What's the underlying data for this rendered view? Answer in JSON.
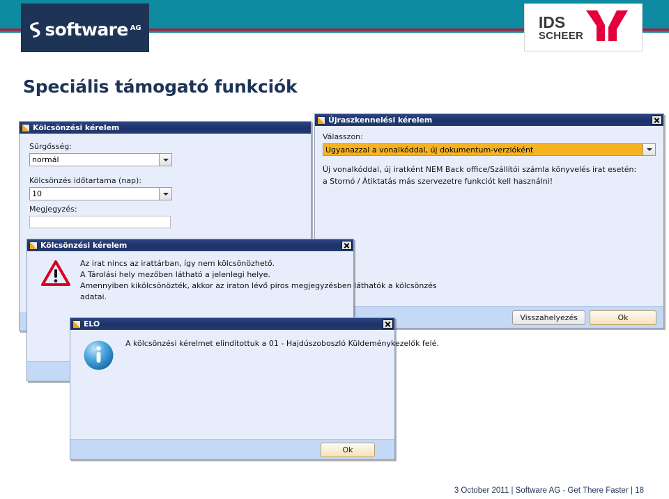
{
  "header": {
    "brand_name": "software",
    "brand_suffix": "AG",
    "partner_line1": "IDS",
    "partner_line2": "SCHEER",
    "teal": "#0e8ba0",
    "red": "#c8102e",
    "navy": "#1e3456"
  },
  "slide": {
    "title": "Speciális támogató funkciók"
  },
  "dialogs": {
    "loan_request_form": {
      "title": "Kölcsönzési kérelem",
      "fields": {
        "urgency_label": "Sűrgősség:",
        "urgency_value": "normál",
        "duration_label": "Kölcsönzés időtartama (nap):",
        "duration_value": "10",
        "note_label": "Megjegyzés:",
        "note_value": ""
      }
    },
    "rescan_request": {
      "title": "Újraszkennelési kérelem",
      "choose_label": "Válasszon:",
      "choice_value": "Ugyanazzal a vonalkóddal, új dokumentum-verzióként",
      "choice_highlight_color": "#f5b324",
      "hint_line1": "Új vonalkóddal, új iratként NEM Back office/Szállítói számla könyvelés irat esetén:",
      "hint_line2": "a Stornó / Átiktatás más szervezetre funkciót kell használni!",
      "buttons": {
        "secondary": "Visszahelyezés",
        "primary": "Ok"
      }
    },
    "loan_request_warning": {
      "title": "Kölcsönzési kérelem",
      "icon": "warning-triangle-icon",
      "line1": "Az irat nincs az irattárban, így nem kölcsönözhető.",
      "line2": "A Tárolási hely mezőben látható a jelenlegi helye.",
      "line3": "Amennyiben kikölcsönözték, akkor az iraton lévő piros megjegyzésben láthatók a kölcsönzés",
      "line4": "adatai."
    },
    "elo_info": {
      "title": "ELO",
      "icon": "info-circle-icon",
      "message": "A kölcsönzési kérelmet elindítottuk a 01 - Hajdúszoboszló Küldeménykezelők felé.",
      "buttons": {
        "primary": "Ok"
      }
    }
  },
  "footer": {
    "date": "3 October 2011",
    "sep1": "|",
    "tagline": "Software AG - Get There Faster",
    "sep2": "|",
    "page": "18"
  }
}
